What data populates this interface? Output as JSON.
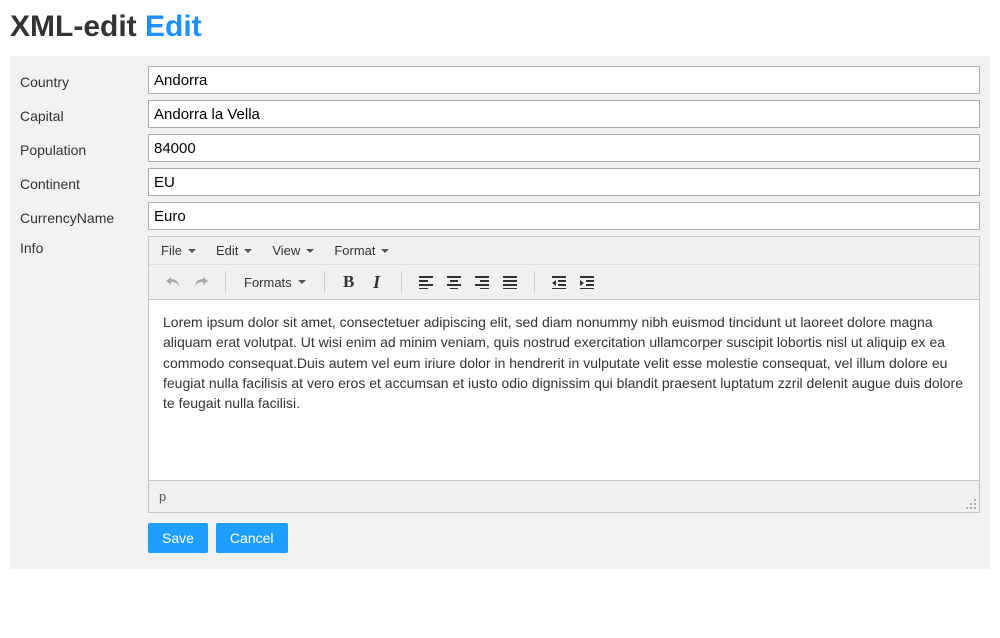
{
  "title": {
    "main": "XML-edit",
    "accent": "Edit"
  },
  "labels": {
    "country": "Country",
    "capital": "Capital",
    "population": "Population",
    "continent": "Continent",
    "currency": "CurrencyName",
    "info": "Info"
  },
  "fields": {
    "country": "Andorra",
    "capital": "Andorra la Vella",
    "population": "84000",
    "continent": "EU",
    "currency": "Euro"
  },
  "editor": {
    "menus": {
      "file": "File",
      "edit": "Edit",
      "view": "View",
      "format": "Format"
    },
    "formats_label": "Formats",
    "content": "Lorem ipsum dolor sit amet, consectetuer adipiscing elit, sed diam nonummy nibh euismod tincidunt ut laoreet dolore magna aliquam erat volutpat. Ut wisi enim ad minim veniam, quis nostrud exercitation ullamcorper suscipit lobortis nisl ut aliquip ex ea commodo consequat.Duis autem vel eum iriure dolor in hendrerit in vulputate velit esse molestie consequat, vel illum dolore eu feugiat nulla facilisis at vero eros et accumsan et iusto odio dignissim qui blandit praesent luptatum zzril delenit augue duis dolore te feugait nulla facilisi.",
    "status_path": "p"
  },
  "buttons": {
    "save": "Save",
    "cancel": "Cancel"
  }
}
